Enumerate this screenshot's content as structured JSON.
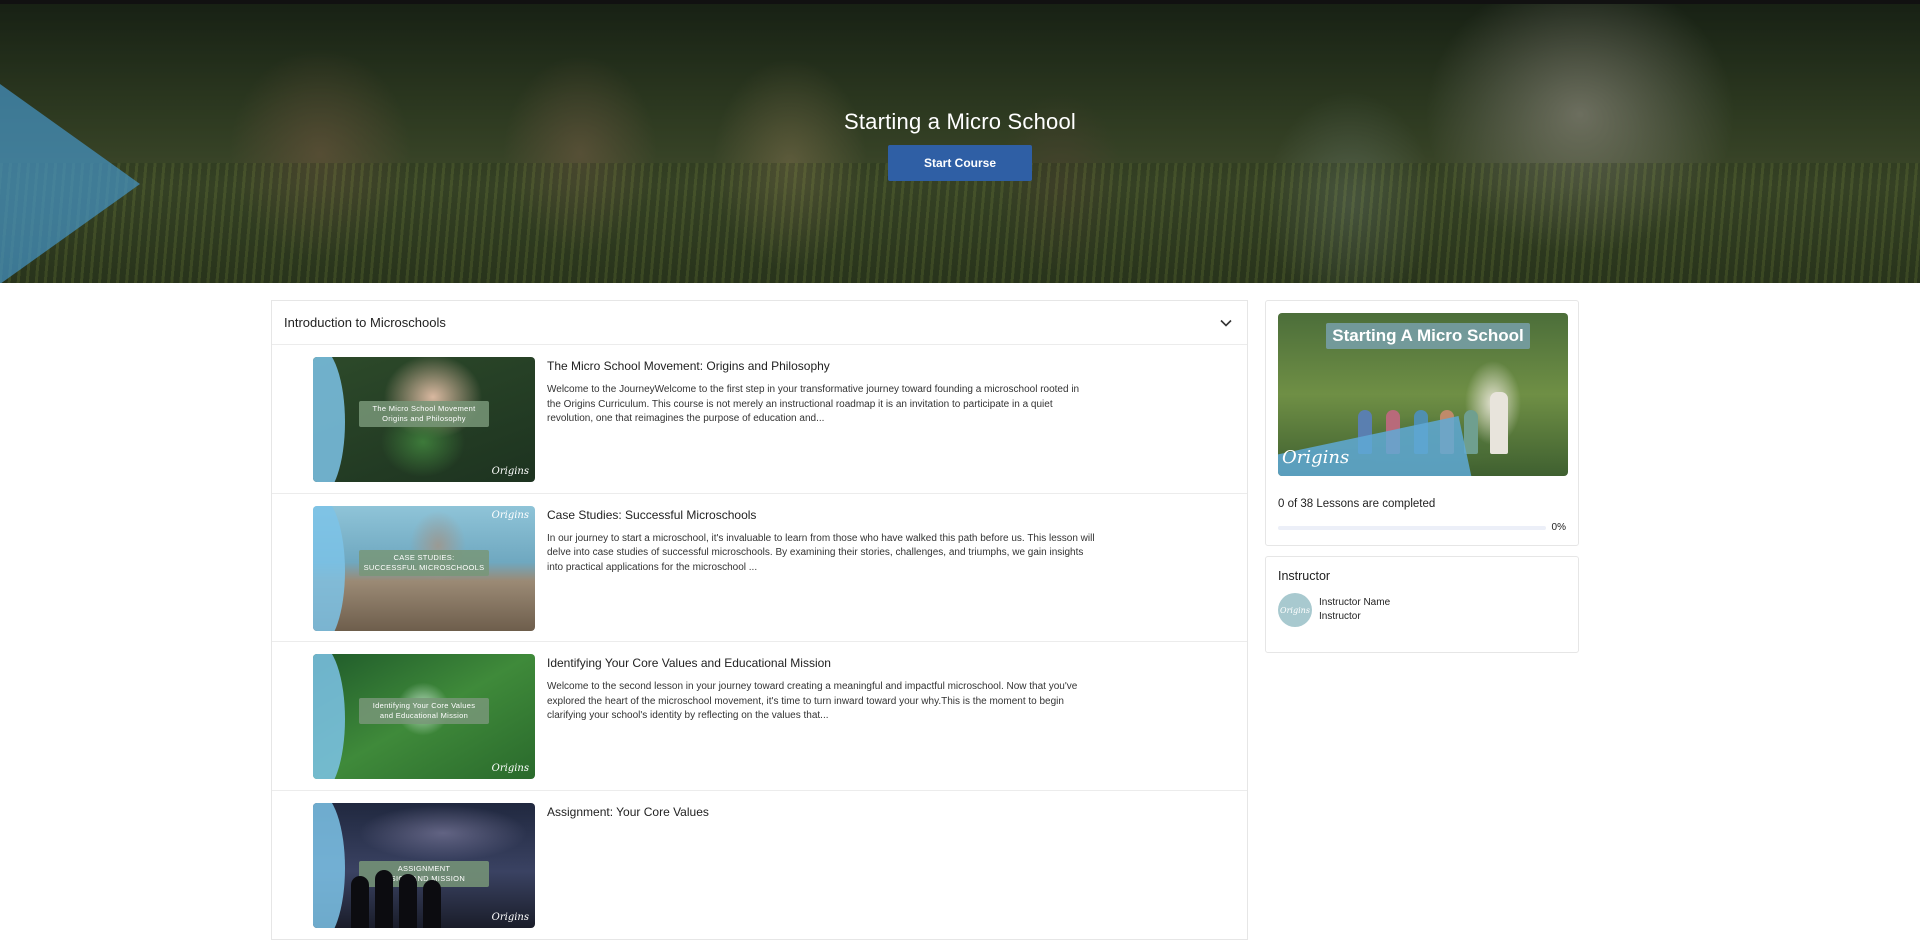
{
  "hero": {
    "title": "Starting a Micro School",
    "start_button": "Start Course"
  },
  "section": {
    "title": "Introduction to Microschools",
    "lessons": [
      {
        "title": "The Micro School Movement: Origins and Philosophy",
        "description": "Welcome to the JourneyWelcome to the first step in your transformative journey toward founding a microschool rooted in the Origins Curriculum. This course is not merely an instructional roadmap it is an invitation to participate in a quiet revolution, one that reimagines the purpose of education and...",
        "thumb_text": "The Micro School Movement\nOrigins and Philosophy",
        "brand": "Origins"
      },
      {
        "title": "Case Studies: Successful Microschools",
        "description": "In our journey to start a microschool, it's invaluable to learn from those who have walked this path before us. This lesson will delve into case studies of successful microschools. By examining their stories, challenges, and triumphs, we gain insights into practical applications for the microschool ...",
        "thumb_text": "CASE STUDIES:\nSUCCESSFUL MICROSCHOOLS",
        "brand": "Origins"
      },
      {
        "title": "Identifying Your Core Values and Educational Mission",
        "description": "Welcome to the second lesson in your journey toward creating a meaningful and impactful microschool. Now that you've explored the heart of the microschool movement, it's time to turn inward toward your why.This is the moment to begin clarifying your school's identity by reflecting on the values that...",
        "thumb_text": "Identifying Your Core Values\nand Educational Mission",
        "brand": "Origins"
      },
      {
        "title": "Assignment: Your Core Values",
        "description": "",
        "thumb_text": "ASSIGNMENT\nVISION AND MISSION",
        "brand": "Origins"
      }
    ]
  },
  "sidebar": {
    "course_image_title": "Starting A Micro School",
    "course_image_brand": "Origins",
    "progress_text": "0 of 38 Lessons are completed",
    "progress_fraction": 0,
    "progress_pct": "0%",
    "instructor_heading": "Instructor",
    "instructor_name": "Instructor Name",
    "instructor_role": "Instructor",
    "avatar_text": "Origins"
  },
  "colors": {
    "primary_button": "#2f5fa5",
    "accent_wave": "#7cc3e8"
  },
  "icons": {
    "section_toggle": "chevron-down-icon"
  }
}
